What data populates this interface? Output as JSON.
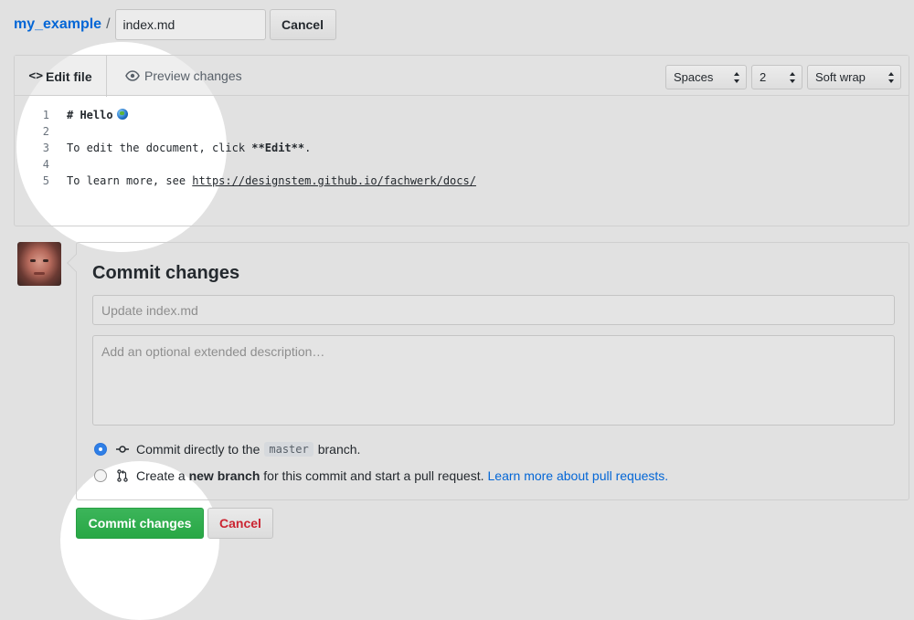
{
  "breadcrumb": {
    "repo": "my_example",
    "separator": "/",
    "filename": "index.md",
    "cancel_label": "Cancel"
  },
  "editor": {
    "tabs": {
      "edit": "Edit file",
      "preview": "Preview changes"
    },
    "indent_mode": "Spaces",
    "indent_size": "2",
    "wrap_mode": "Soft wrap",
    "lines": [
      {
        "num": "1",
        "prefix": "",
        "bold": "# Hello",
        "suffix": "",
        "url": "",
        "emoji": "globe"
      },
      {
        "num": "2",
        "prefix": "",
        "bold": "",
        "suffix": "",
        "url": ""
      },
      {
        "num": "3",
        "prefix": "To edit the document, click ",
        "bold": "**Edit**",
        "suffix": ".",
        "url": ""
      },
      {
        "num": "4",
        "prefix": "",
        "bold": "",
        "suffix": "",
        "url": ""
      },
      {
        "num": "5",
        "prefix": "To learn more, see ",
        "bold": "",
        "suffix": "",
        "url": "https://designstem.github.io/fachwerk/docs/"
      }
    ]
  },
  "commit": {
    "title": "Commit changes",
    "summary_placeholder": "Update index.md",
    "description_placeholder": "Add an optional extended description…",
    "option_direct": {
      "pre": "Commit directly to the",
      "branch": "master",
      "post": "branch.",
      "selected": true
    },
    "option_new": {
      "pre": "Create a",
      "bold": "new branch",
      "post": "for this commit and start a pull request.",
      "link": "Learn more about pull requests.",
      "selected": false
    },
    "submit_label": "Commit changes",
    "cancel_label": "Cancel"
  },
  "colors": {
    "primary": "#28a745",
    "link": "#0366d6",
    "danger": "#cb2431"
  }
}
